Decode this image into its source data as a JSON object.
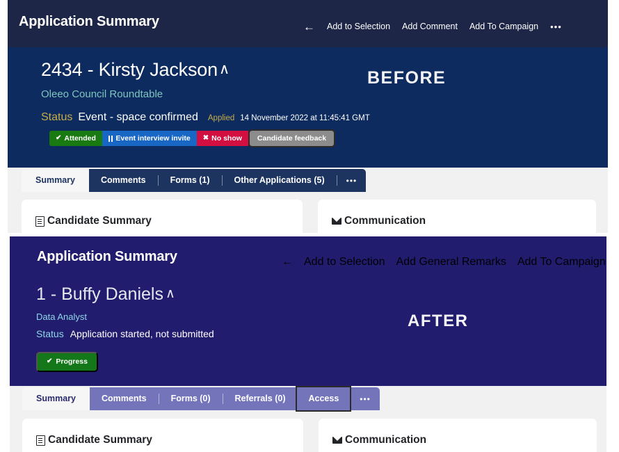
{
  "before": {
    "header": {
      "title": "Application Summary",
      "back_icon": "back-arrow-icon",
      "actions": [
        "Add to Selection",
        "Add Comment",
        "Add To Campaign"
      ],
      "overflow": "•••"
    },
    "hero": {
      "name": "2434 - Kirsty Jackson",
      "collapse_caret": "∧",
      "subtitle": "Oleeo Council Roundtable",
      "status_label": "Status",
      "status_value": "Event - space confirmed",
      "applied_label": "Applied",
      "applied_date": "14 November 2022 at 11:45:41 GMT"
    },
    "buttons": [
      {
        "label": "Attended",
        "icon": "check-icon",
        "color": "#1a7a12"
      },
      {
        "label": "Event interview invite",
        "icon": "pause-icon",
        "color": "#1967c4"
      },
      {
        "label": "No show",
        "icon": "cross-icon",
        "color": "#d30f42"
      },
      {
        "label": "Candidate feedback",
        "icon": "none",
        "color": "#8c8c8c"
      }
    ],
    "tabs": {
      "active": "Summary",
      "rest": [
        "Comments",
        "Forms (1)",
        "Other Applications (5)"
      ],
      "overflow": "•••"
    },
    "cards": [
      {
        "title": "Candidate Summary",
        "icon": "document-icon"
      },
      {
        "title": "Communication",
        "icon": "envelope-icon"
      }
    ],
    "watermark": "BEFORE"
  },
  "after": {
    "header": {
      "title": "Application Summary",
      "back_icon": "back-arrow-icon",
      "actions": [
        "Add to Selection",
        "Add General Remarks",
        "Add To Campaign"
      ]
    },
    "hero": {
      "name": "1 - Buffy Daniels",
      "collapse_caret": "∧",
      "subtitle": "Data Analyst",
      "status_label": "Status",
      "status_value": "Application started, not submitted"
    },
    "buttons": [
      {
        "label": "Progress",
        "icon": "check-icon",
        "color": "#14781a"
      }
    ],
    "tabs": {
      "active": "Summary",
      "rest": [
        "Comments",
        "Forms (0)",
        "Referrals (0)"
      ],
      "focused": "Access",
      "overflow": "•••"
    },
    "cards": [
      {
        "title": "Candidate Summary",
        "icon": "document-icon"
      },
      {
        "title": "Communication",
        "icon": "envelope-icon"
      }
    ],
    "watermark": "AFTER"
  },
  "glyphs": {
    "check": "✔",
    "cross": "✖",
    "back": "←"
  },
  "colors": {
    "before_topbar": "#1d2647",
    "before_hero": "#0d2b5e",
    "after_hero": "#211c6e",
    "page_bg": "#f1f1f2",
    "accent_gold": "#c7ad48",
    "accent_teal": "#7fc5bf",
    "accent_cyan": "#8fd6e8"
  }
}
